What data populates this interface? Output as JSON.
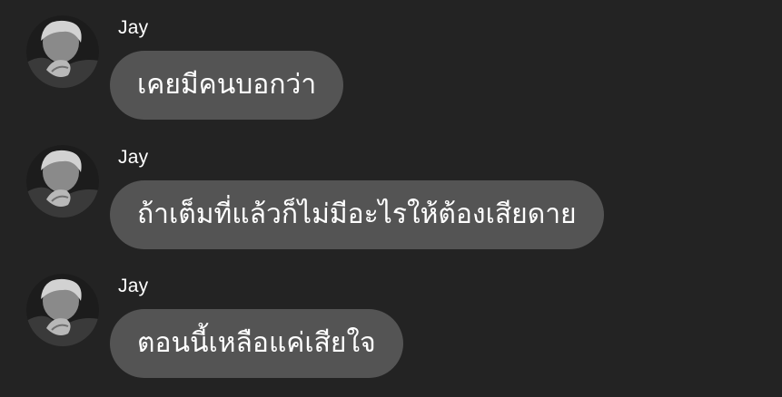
{
  "colors": {
    "background": "#232323",
    "bubble": "#545454",
    "text": "#ffffff"
  },
  "messages": [
    {
      "sender": "Jay",
      "avatar_icon": "profile-photo-icon",
      "text": "เคยมีคนบอกว่า"
    },
    {
      "sender": "Jay",
      "avatar_icon": "profile-photo-icon",
      "text": "ถ้าเต็มที่แล้วก็ไม่มีอะไรให้ต้องเสียดาย"
    },
    {
      "sender": "Jay",
      "avatar_icon": "profile-photo-icon",
      "text": "ตอนนี้เหลือแค่เสียใจ"
    }
  ]
}
